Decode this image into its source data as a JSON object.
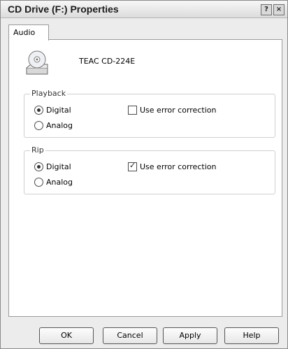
{
  "window": {
    "title": "CD Drive (F:) Properties",
    "help_glyph": "?",
    "close_glyph": "×"
  },
  "tabs": [
    {
      "label": "Audio"
    }
  ],
  "device": {
    "name": "TEAC CD-224E",
    "icon": "cd-drive-icon"
  },
  "playback": {
    "label": "Playback",
    "digital_label": "Digital",
    "analog_label": "Analog",
    "selected": "Digital",
    "error_correction_label": "Use error correction",
    "error_correction_checked": false
  },
  "rip": {
    "label": "Rip",
    "digital_label": "Digital",
    "analog_label": "Analog",
    "selected": "Digital",
    "error_correction_label": "Use error correction",
    "error_correction_checked": true
  },
  "buttons": {
    "ok": "OK",
    "cancel": "Cancel",
    "apply": "Apply",
    "help": "Help"
  }
}
